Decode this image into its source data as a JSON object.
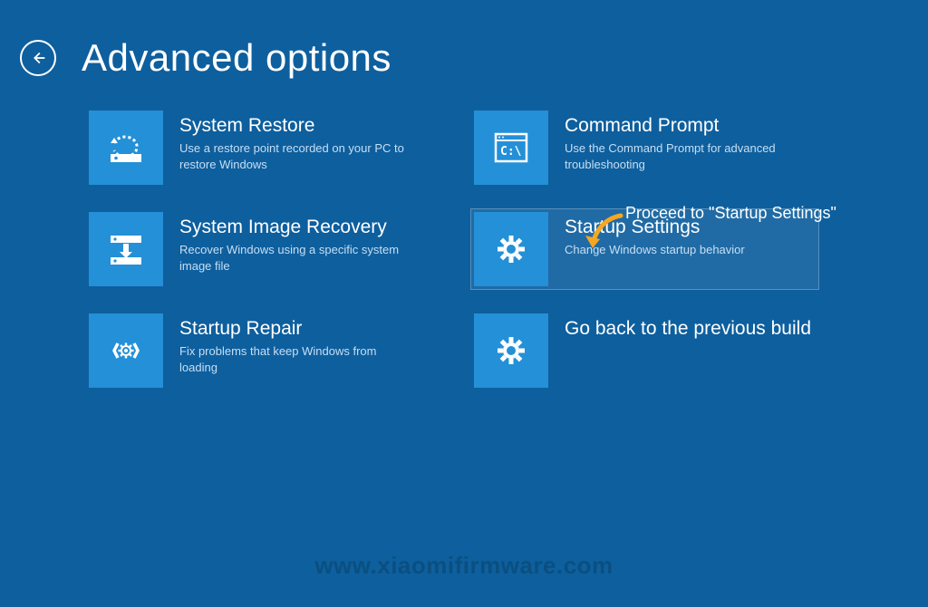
{
  "header": {
    "title": "Advanced options"
  },
  "tiles": {
    "system_restore": {
      "title": "System Restore",
      "desc": "Use a restore point recorded on your PC to restore Windows"
    },
    "system_image_recovery": {
      "title": "System Image Recovery",
      "desc": "Recover Windows using a specific system image file"
    },
    "startup_repair": {
      "title": "Startup Repair",
      "desc": "Fix problems that keep Windows from loading"
    },
    "command_prompt": {
      "title": "Command Prompt",
      "desc": "Use the Command Prompt for advanced troubleshooting"
    },
    "startup_settings": {
      "title": "Startup Settings",
      "desc": "Change Windows startup behavior"
    },
    "go_back": {
      "title": "Go back to the previous build",
      "desc": ""
    }
  },
  "annotation": {
    "text": "Proceed to \"Startup Settings\""
  },
  "watermark": "www.xiaomifirmware.com"
}
